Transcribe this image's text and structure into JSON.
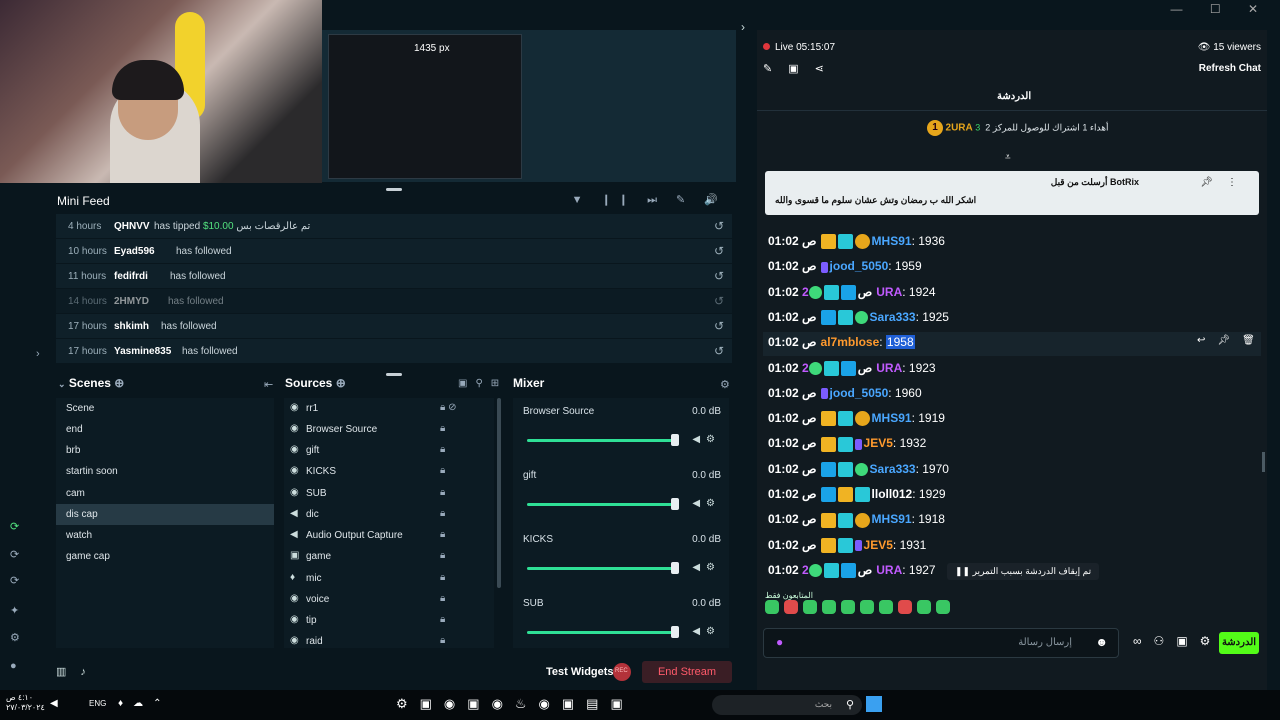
{
  "preview": {
    "width_label": "1435 px"
  },
  "window": {
    "controls": "— ☐ ✕"
  },
  "mini_feed": {
    "title": "Mini Feed",
    "tools": "▼ ❙❙ ⏭ ✎ 🔊",
    "rows": [
      {
        "time": "4 hours",
        "user": "QHNVV",
        "action": "has tipped",
        "amount": "$10.00",
        "message": "تم عالرقصات بس"
      },
      {
        "time": "10 hours",
        "user": "Eyad596",
        "action": "has followed"
      },
      {
        "time": "11 hours",
        "user": "fedifrdi",
        "action": "has followed"
      },
      {
        "time": "14 hours",
        "user": "2HMYD",
        "action": "has followed"
      },
      {
        "time": "17 hours",
        "user": "shkimh",
        "action": "has followed"
      },
      {
        "time": "17 hours",
        "user": "Yasmine835",
        "action": "has followed"
      }
    ],
    "replay_icon": "↺"
  },
  "scenes": {
    "title": "Scenes",
    "items": [
      "Scene",
      "end",
      "brb",
      "startin soon",
      "cam",
      "dis cap",
      "watch",
      "game cap"
    ],
    "selected": "dis cap"
  },
  "sources": {
    "title": "Sources",
    "items": [
      "rr1",
      "Browser Source",
      "gift",
      "KICKS",
      "SUB",
      "dic",
      "Audio Output Capture",
      "game",
      "mic",
      "voice",
      "tip",
      "raid"
    ]
  },
  "mixer": {
    "title": "Mixer",
    "channels": [
      {
        "name": "Browser Source",
        "db": "0.0 dB"
      },
      {
        "name": "gift",
        "db": "0.0 dB"
      },
      {
        "name": "KICKS",
        "db": "0.0 dB"
      },
      {
        "name": "SUB",
        "db": "0.0 dB"
      }
    ]
  },
  "bottom": {
    "test_widgets": "Test Widgets",
    "rec": "REC",
    "end_stream": "End Stream"
  },
  "chat": {
    "live": "Live 05:15:07",
    "viewers": "15 viewers",
    "refresh": "Refresh Chat",
    "tab": "الدردشة",
    "top_user": {
      "rank": "1",
      "name": "2URA",
      "count": "3"
    },
    "sub_info": "أهداء 1 اشتراك للوصول للمركز 2",
    "pinned": {
      "author": "BotRix",
      "header": "أرسلت من قبل",
      "text": "اشكر الله ب رمضان وتش عشان سلوم ما قسوى والله"
    },
    "messages": [
      {
        "time": "01:02 ص",
        "name": "MHS91",
        "text": ": 1936",
        "color": "blue",
        "badges": [
          "crown",
          "gg",
          "coin"
        ]
      },
      {
        "time": "01:02 ص",
        "name": "jood_5050",
        "text": ": 1959",
        "color": "blue",
        "badges": [
          "sub"
        ]
      },
      {
        "time": "01:02 ص",
        "name": "2URA",
        "text": ": 1924",
        "color": "purple",
        "badges": [
          "sword",
          "gg",
          "ok"
        ]
      },
      {
        "time": "01:02 ص",
        "name": "Sara333",
        "text": ": 1925",
        "color": "blue",
        "badges": [
          "sword",
          "gg",
          "ok"
        ]
      },
      {
        "time": "01:02 ص",
        "name": "al7mblose",
        "text": ": ",
        "highlight": "1958",
        "color": "orange",
        "badges": []
      },
      {
        "time": "01:02 ص",
        "name": "2URA",
        "text": ": 1923",
        "color": "purple",
        "badges": [
          "sword",
          "gg",
          "ok"
        ]
      },
      {
        "time": "01:02 ص",
        "name": "jood_5050",
        "text": ": 1960",
        "color": "blue",
        "badges": [
          "sub"
        ]
      },
      {
        "time": "01:02 ص",
        "name": "MHS91",
        "text": ": 1919",
        "color": "blue",
        "badges": [
          "crown",
          "gg",
          "coin"
        ]
      },
      {
        "time": "01:02 ص",
        "name": "JEV5",
        "text": ": 1932",
        "color": "orange",
        "badges": [
          "crown",
          "gg",
          "sub"
        ]
      },
      {
        "time": "01:02 ص",
        "name": "Sara333",
        "text": ": 1970",
        "color": "blue",
        "badges": [
          "sword",
          "gg",
          "ok"
        ]
      },
      {
        "time": "01:02 ص",
        "name": "lloll012",
        "text": ": 1929",
        "color": "white",
        "badges": [
          "sword",
          "crown",
          "gg"
        ]
      },
      {
        "time": "01:02 ص",
        "name": "MHS91",
        "text": ": 1918",
        "color": "blue",
        "badges": [
          "crown",
          "gg",
          "coin"
        ]
      },
      {
        "time": "01:02 ص",
        "name": "JEV5",
        "text": ": 1931",
        "color": "orange",
        "badges": [
          "crown",
          "gg",
          "sub"
        ]
      },
      {
        "time": "01:02 ص",
        "name": "2URA",
        "text": ": 1927",
        "color": "purple",
        "badges": [
          "sword",
          "gg",
          "ok"
        ]
      }
    ],
    "paused_banner": "❚❚ تم إيقاف الدردشة بسبب التمرير",
    "sub_only": "المتابعون فقط",
    "input_placeholder": "إرسال رسالة",
    "send": "الدردشة"
  },
  "taskbar": {
    "clock_time": "٤:١٠ ص",
    "clock_date": "٢٧/٠٣/٢٠٢٤",
    "lang": "ENG",
    "search_placeholder": "بحث"
  }
}
